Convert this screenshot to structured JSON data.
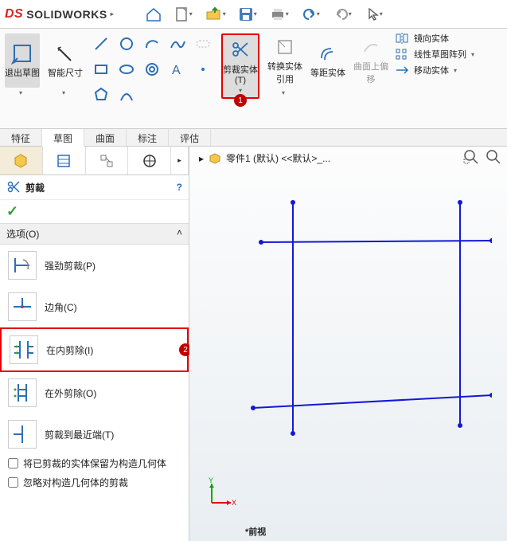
{
  "app": {
    "name": "SOLIDWORKS",
    "logo_prefix": "DS"
  },
  "titlebar_dropdown": "▸",
  "ribbon": {
    "exit_sketch": "退出草图",
    "smart_dim": "智能尺寸",
    "trim_entity": "剪裁实体(T)",
    "convert_entity": "转换实体引用",
    "offset_entity": "等距实体",
    "surface_offset": "曲面上偏移",
    "mirror_entity": "镜向实体",
    "linear_pattern": "线性草图阵列",
    "move_entity": "移动实体"
  },
  "tabs": [
    "特征",
    "草图",
    "曲面",
    "标注",
    "评估"
  ],
  "panel": {
    "title": "剪裁",
    "section": "选项(O)",
    "options": [
      {
        "label": "强劲剪裁(P)"
      },
      {
        "label": "边角(C)"
      },
      {
        "label": "在内剪除(I)"
      },
      {
        "label": "在外剪除(O)"
      },
      {
        "label": "剪裁到最近端(T)"
      }
    ],
    "chk1": "将已剪裁的实体保留为构造几何体",
    "chk2": "忽略对构造几何体的剪裁"
  },
  "crumb": {
    "part": "零件1 (默认) <<默认>_..."
  },
  "footer_view": "*前视",
  "callouts": {
    "c1": "1",
    "c2": "2"
  },
  "help": "?"
}
